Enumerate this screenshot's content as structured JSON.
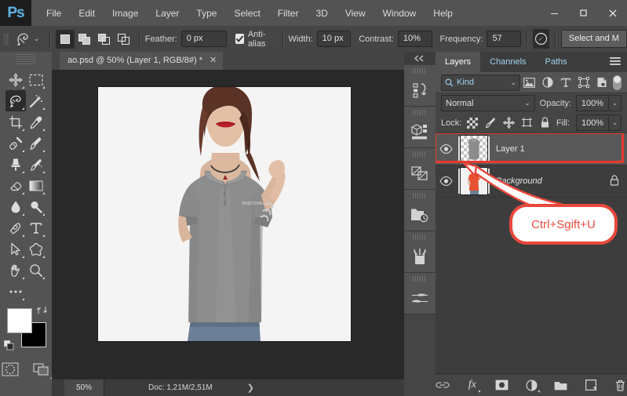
{
  "app": {
    "logo": "Ps",
    "menus": [
      "File",
      "Edit",
      "Image",
      "Layer",
      "Type",
      "Select",
      "Filter",
      "3D",
      "View",
      "Window",
      "Help"
    ],
    "window_controls": {
      "minimize": "—",
      "maximize": "▢",
      "close": "✕"
    }
  },
  "options_bar": {
    "tool_icon": "lasso-magnetic-icon",
    "selection_modes": [
      "new-selection",
      "add-to-selection",
      "subtract-from-selection",
      "intersect-selection"
    ],
    "feather_label": "Feather:",
    "feather_value": "0 px",
    "antialias_label": "Anti-alias",
    "antialias_checked": true,
    "width_label": "Width:",
    "width_value": "10 px",
    "contrast_label": "Contrast:",
    "contrast_value": "10%",
    "frequency_label": "Frequency:",
    "frequency_value": "57",
    "pen_pressure_icon": "pen-pressure-icon",
    "select_mask_label": "Select and M"
  },
  "toolbar": {
    "tools": [
      "move-tool",
      "rectangular-marquee-tool",
      "magnetic-lasso-tool",
      "magic-wand-tool",
      "crop-tool",
      "eyedropper-tool",
      "healing-brush-tool",
      "brush-tool",
      "clone-stamp-tool",
      "history-brush-tool",
      "eraser-tool",
      "gradient-tool",
      "blur-tool",
      "dodge-tool",
      "pen-tool",
      "horizontal-type-tool",
      "path-selection-tool",
      "custom-shape-tool",
      "hand-tool",
      "zoom-tool",
      "edit-toolbar-ellipsis"
    ],
    "active_tool": "magnetic-lasso-tool",
    "foreground_color": "#ffffff",
    "background_color": "#000000",
    "swap_icon": "swap-colors-icon",
    "default_icon": "default-colors-icon",
    "quick_mask_icon": "quick-mask-icon",
    "screen_mode_icon": "screen-mode-icon"
  },
  "document": {
    "tab_title": "ao.psd @ 50% (Layer 1, RGB/8#) *",
    "tab_close": "✕",
    "shirt_logo_text": "DISCOVERY"
  },
  "status_bar": {
    "zoom": "50%",
    "doc_info": "Doc: 1,21M/2,51M",
    "expand_arrow": "❯"
  },
  "icon_dock": {
    "collapse_icon": "double-chevron-left-icon",
    "items": [
      "history-actions-icon",
      "3d-panel-icon",
      "adjustments-icon",
      "history-panel-icon",
      "brushes-panel-icon",
      "brush-settings-icon"
    ]
  },
  "layers_panel": {
    "tabs": [
      {
        "label": "Layers",
        "active": true
      },
      {
        "label": "Channels",
        "active": false
      },
      {
        "label": "Paths",
        "active": false
      }
    ],
    "menu_icon": "panel-menu-icon",
    "filter": {
      "search_icon": "search-icon",
      "kind_label": "Kind",
      "caret": "⌄",
      "filter_icons": [
        "filter-pixel-icon",
        "filter-adjustment-icon",
        "filter-type-icon",
        "filter-shape-icon",
        "filter-smart-object-icon"
      ],
      "toggle_on": true
    },
    "blend": {
      "mode": "Normal",
      "caret": "⌄",
      "opacity_label": "Opacity:",
      "opacity_value": "100%"
    },
    "lock": {
      "label": "Lock:",
      "icons": [
        "lock-transparent-pixels-icon",
        "lock-image-pixels-icon",
        "lock-position-icon",
        "lock-artboard-icon",
        "lock-all-icon"
      ],
      "fill_label": "Fill:",
      "fill_value": "100%"
    },
    "layers": [
      {
        "name": "Layer 1",
        "visible": true,
        "selected": true,
        "locked": false,
        "italic": false,
        "thumb": "desaturated-shirt-transparent",
        "highlighted": true
      },
      {
        "name": "Background",
        "visible": true,
        "selected": false,
        "locked": true,
        "italic": true,
        "thumb": "original-orange-shirt-photo",
        "highlighted": false
      }
    ],
    "footer_icons": [
      "link-layers-icon",
      "add-layer-style-icon",
      "add-layer-mask-icon",
      "new-fill-adjustment-icon",
      "new-group-icon",
      "new-layer-icon",
      "delete-layer-icon"
    ],
    "footer_fx_label": "fx"
  },
  "annotation": {
    "callout_text": "Ctrl+Sgift+U",
    "callout_color": "#ee4b3c",
    "highlight_color": "#e8392e"
  }
}
